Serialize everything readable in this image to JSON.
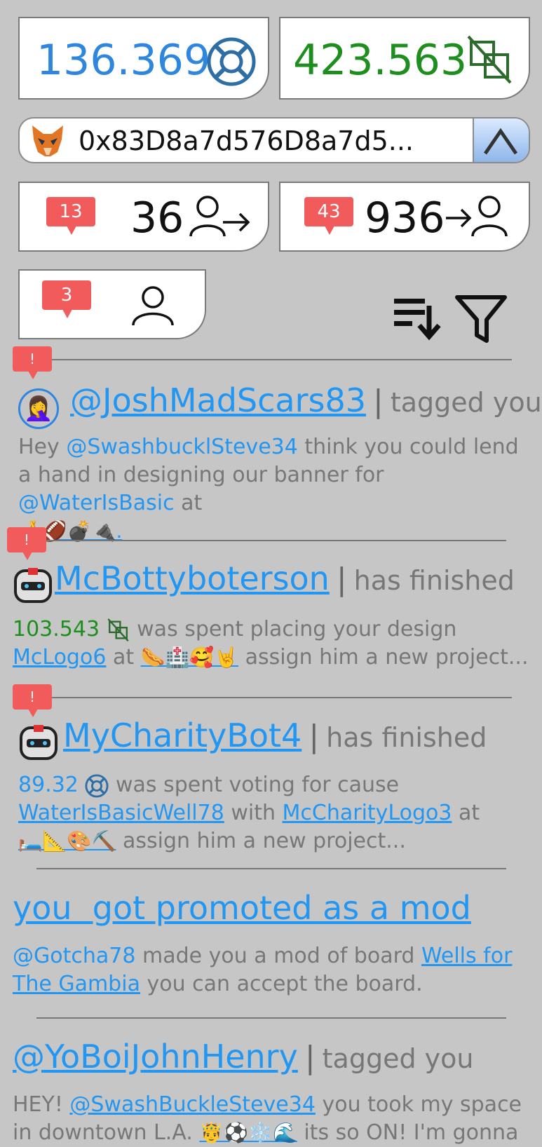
{
  "balances": {
    "blue_value": "136.369",
    "green_value": "423.563",
    "blue_color": "#2e86de",
    "green_color": "#1e8f1e",
    "blue_icon": "lifebuoy-icon",
    "green_icon": "crossed-squares-icon"
  },
  "wallet": {
    "address": "0x83D8a7d576D8a7d5...",
    "icon": "metamask-fox-icon",
    "toggle_icon": "chevron-up-icon"
  },
  "stats": {
    "followers": {
      "badge": "13",
      "count": "36"
    },
    "following": {
      "badge": "43",
      "count": "936"
    },
    "profile": {
      "badge": "3"
    }
  },
  "toolbar": {
    "sort_icon": "sort-descending-icon",
    "filter_icon": "filter-icon"
  },
  "feed": [
    {
      "alert": "!",
      "user": "@JoshMadScars83",
      "sep": "|",
      "action": "tagged you",
      "text1": "Hey ",
      "mention": "@SwashbucklSteve34",
      "text2": " think you could lend a hand in designing our banner for ",
      "mention2": "@WaterIsBasic",
      "text3": " at",
      "emojis": "🤞🏈💣🔌."
    },
    {
      "alert": "!",
      "user": "McBottyboterson",
      "sep": "|",
      "action": "has finished",
      "amount": "103.543",
      "text1": " was spent placing your design",
      "design": "McLogo6",
      "text2": " at ",
      "emojis": "🌭🏥🥰🤘",
      "text3": " assign him a new project..."
    },
    {
      "alert": "!",
      "user": "MyCharityBot4",
      "sep": "|",
      "action": "has finished",
      "amount": "89.32",
      "text1": " was spent voting for cause",
      "cause": "WaterIsBasicWell78",
      "text2": " with ",
      "design": "McCharityLogo3",
      "text3": " at",
      "emojis": "🛏️📐🎨⛏️",
      "text4": " assign him a new project..."
    },
    {
      "title": "you  got promoted as a mod",
      "user": "@Gotcha78",
      "text1": " made you a mod of board ",
      "board": "Wells for The Gambia",
      "text2": " you can accept the board."
    },
    {
      "user": "@YoBoiJohnHenry",
      "sep": "|",
      "action": "tagged you",
      "text1": "HEY! ",
      "mention": "@SwashBuckleSteve34",
      "text2": " you took my space in downtown L.A. ",
      "emojis": "🤴⚽❄️🌊",
      "text3": " its so ON! I'm gonna"
    }
  ]
}
